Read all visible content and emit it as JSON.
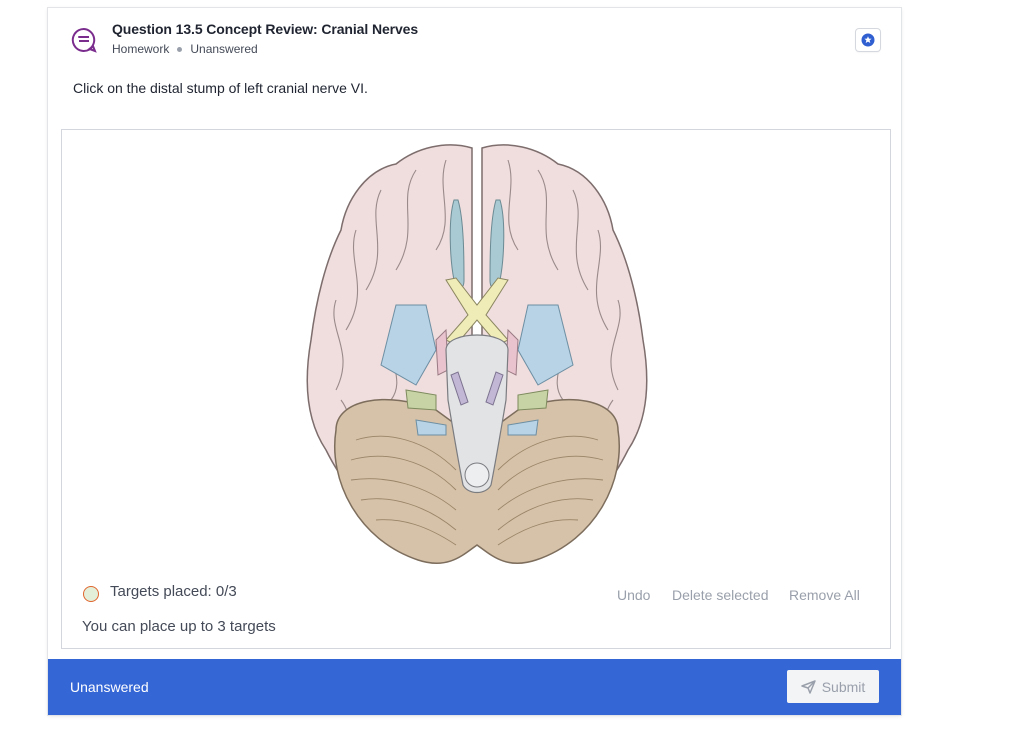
{
  "question": {
    "title": "Question 13.5 Concept Review: Cranial Nerves",
    "type": "Homework",
    "status": "Unanswered",
    "prompt": "Click on the distal stump of left cranial nerve VI.",
    "icon": "question-bubble-icon",
    "bookmark_icon": "star-icon"
  },
  "workspace": {
    "image_name": "brain-inferior-view",
    "targets_placed": "Targets placed: 0/3",
    "targets_note": "You can place up to 3 targets",
    "tools": {
      "undo": "Undo",
      "delete_selected": "Delete selected",
      "remove_all": "Remove All"
    }
  },
  "footer": {
    "status": "Unanswered",
    "submit_label": "Submit",
    "submit_icon": "paper-plane-icon",
    "accent": "#3566d6"
  }
}
